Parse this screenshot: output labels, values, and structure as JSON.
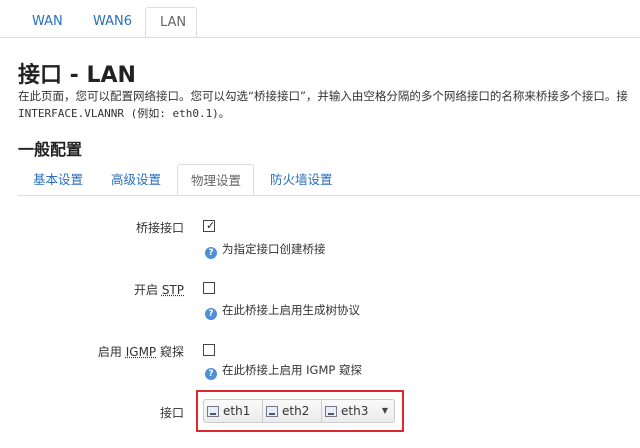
{
  "top_tabs": {
    "items": [
      {
        "label": "WAN"
      },
      {
        "label": "WAN6"
      },
      {
        "label": "LAN"
      }
    ],
    "active": "LAN"
  },
  "page": {
    "title": "接口 - LAN",
    "description": "在此页面，您可以配置网络接口。您可以勾选“桥接接口”，并输入由空格分隔的多个网络接口的名称来桥接多个接口。接",
    "description_line2": "INTERFACE.VLANNR (例如: eth0.1)。"
  },
  "section": {
    "title": "一般配置",
    "tabs": [
      {
        "label": "基本设置"
      },
      {
        "label": "高级设置"
      },
      {
        "label": "物理设置"
      },
      {
        "label": "防火墙设置"
      }
    ],
    "active_tab": "物理设置"
  },
  "fields": {
    "bridge": {
      "label": "桥接接口",
      "checked": true,
      "check_glyph": "✓",
      "hint": "为指定接口创建桥接"
    },
    "stp": {
      "label_prefix": "开启 ",
      "label_abbr": "STP",
      "checked": false,
      "hint": "在此桥接上启用生成树协议"
    },
    "igmp": {
      "label_prefix": "启用 ",
      "label_abbr": "IGMP",
      "label_suffix": " 窥探",
      "checked": false,
      "hint": "在此桥接上启用 IGMP 窥探"
    },
    "interface": {
      "label": "接口",
      "selected": [
        {
          "name": "eth1"
        },
        {
          "name": "eth2"
        },
        {
          "name": "eth3"
        }
      ],
      "caret": "▼"
    }
  },
  "hint_icon": "?",
  "colors": {
    "link": "#2a6ebb",
    "highlight_border": "#e0262e",
    "hint_icon": "#4f8fd6"
  }
}
